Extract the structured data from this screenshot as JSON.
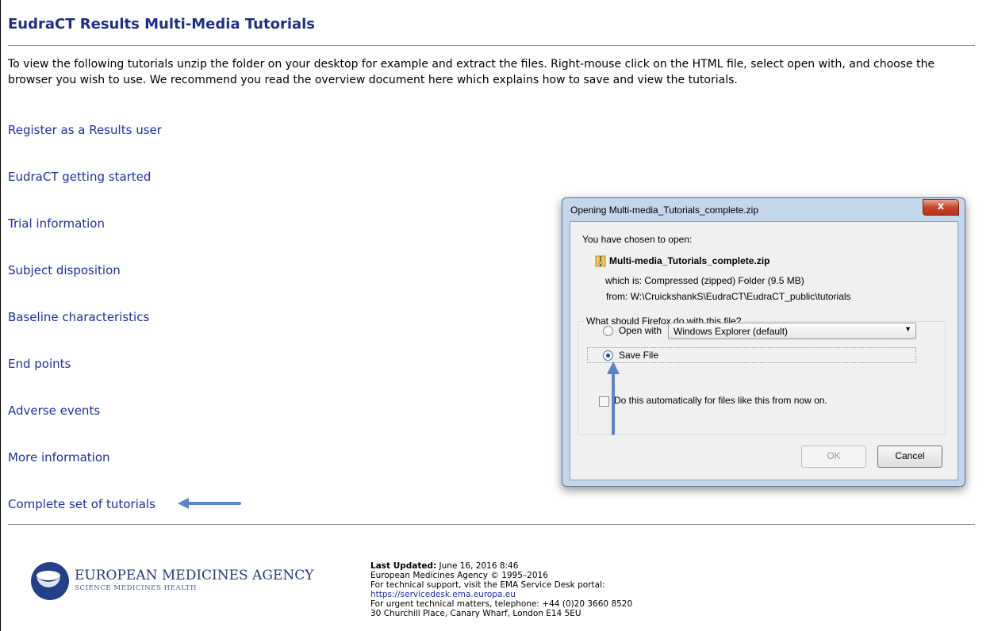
{
  "page": {
    "title": "EudraCT Results Multi-Media Tutorials",
    "intro": "To view the following tutorials unzip the folder on your desktop for example and extract the files. Right-mouse click on the HTML file, select open with, and choose the browser you wish to use. We recommend you read the overview document here which explains how to save and view the tutorials."
  },
  "links": [
    "Register as a Results user",
    "EudraCT getting started",
    "Trial information",
    "Subject disposition",
    "Baseline characteristics",
    "End points",
    "Adverse events",
    "More information",
    "Complete set of tutorials"
  ],
  "footer": {
    "logo_name": "EUROPEAN MEDICINES AGENCY",
    "logo_tagline": "SCIENCE  MEDICINES  HEALTH",
    "last_updated_label": "Last Updated:",
    "last_updated_value": " June 16, 2016 8:46",
    "copyright": "European Medicines Agency © 1995–2016",
    "support": "For technical support, visit the EMA Service Desk portal:",
    "support_url": "https://servicedesk.ema.europa.eu",
    "urgent": "For urgent technical matters, telephone: +44 (0)20 3660 8520",
    "address": "30 Churchill Place, Canary Wharf, London E14 5EU"
  },
  "dialog": {
    "title": "Opening Multi-media_Tutorials_complete.zip",
    "close_label": "x",
    "chosen_label": "You have chosen to open:",
    "file_name": "Multi-media_Tutorials_complete.zip",
    "which_is": "which is:  Compressed (zipped) Folder (9.5 MB)",
    "from": "from:  W:\\CruickshankS\\EudraCT\\EudraCT_public\\tutorials",
    "question": "What should Firefox do with this file?",
    "open_with_label": "Open with",
    "open_with_value": "Windows Explorer (default)",
    "save_file_label": "Save File",
    "auto_label": "Do this automatically for files like this from now on.",
    "ok_label": "OK",
    "cancel_label": "Cancel",
    "selected_option": "Save File"
  },
  "colors": {
    "title": "#1f2f8c",
    "link": "#1f2fa8",
    "annotation_arrow": "#5b85c6"
  }
}
